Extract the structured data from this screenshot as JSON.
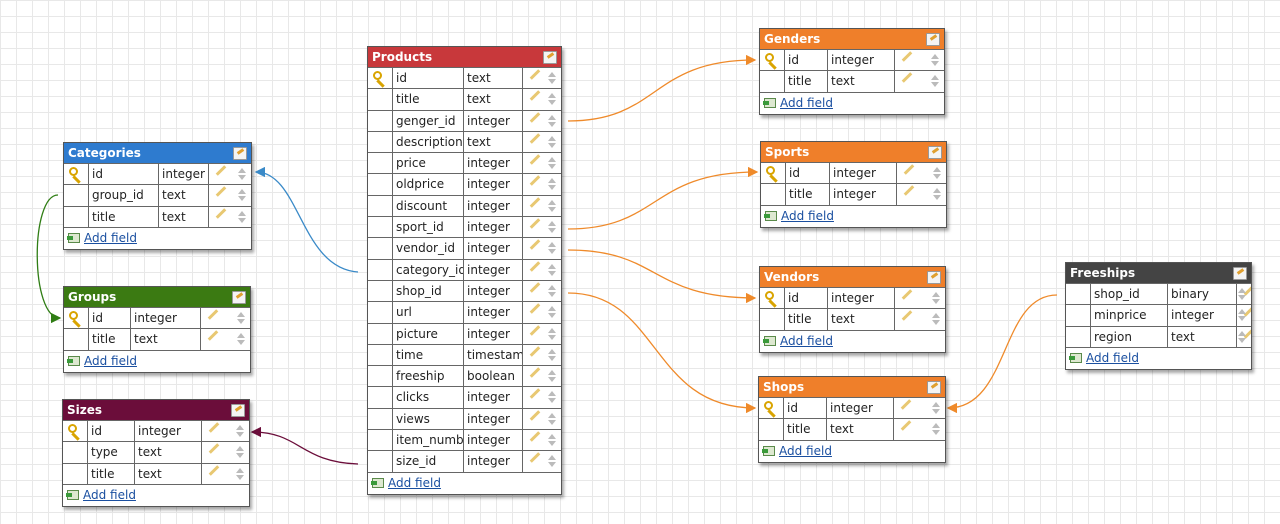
{
  "colors": {
    "blue": "#2e7bcf",
    "green": "#3b7a12",
    "maroon": "#6b0d3a",
    "red": "#c8383b",
    "orange": "#ef7f2a",
    "dark": "#444444",
    "link_blue": "#3a8ac8",
    "link_orange": "#ef8a2a",
    "link_green": "#2f7d14",
    "link_maroon": "#6b0d3a"
  },
  "add_field_label": "Add field",
  "tables": {
    "categories": {
      "title": "Categories",
      "fields": [
        {
          "name": "id",
          "type": "integer",
          "pk": true
        },
        {
          "name": "group_id",
          "type": "text",
          "pk": false
        },
        {
          "name": "title",
          "type": "text",
          "pk": false
        }
      ]
    },
    "groups": {
      "title": "Groups",
      "fields": [
        {
          "name": "id",
          "type": "integer",
          "pk": true
        },
        {
          "name": "title",
          "type": "text",
          "pk": false
        }
      ]
    },
    "sizes": {
      "title": "Sizes",
      "fields": [
        {
          "name": "id",
          "type": "integer",
          "pk": true
        },
        {
          "name": "type",
          "type": "text",
          "pk": false
        },
        {
          "name": "title",
          "type": "text",
          "pk": false
        }
      ]
    },
    "products": {
      "title": "Products",
      "fields": [
        {
          "name": "id",
          "type": "text",
          "pk": true
        },
        {
          "name": "title",
          "type": "text",
          "pk": false
        },
        {
          "name": "genger_id",
          "type": "integer",
          "pk": false
        },
        {
          "name": "description",
          "type": "text",
          "pk": false
        },
        {
          "name": "price",
          "type": "integer",
          "pk": false
        },
        {
          "name": "oldprice",
          "type": "integer",
          "pk": false
        },
        {
          "name": "discount",
          "type": "integer",
          "pk": false
        },
        {
          "name": "sport_id",
          "type": "integer",
          "pk": false
        },
        {
          "name": "vendor_id",
          "type": "integer",
          "pk": false
        },
        {
          "name": "category_id",
          "type": "integer",
          "pk": false
        },
        {
          "name": "shop_id",
          "type": "integer",
          "pk": false
        },
        {
          "name": "url",
          "type": "integer",
          "pk": false
        },
        {
          "name": "picture",
          "type": "integer",
          "pk": false
        },
        {
          "name": "time",
          "type": "timestamp",
          "pk": false
        },
        {
          "name": "freeship",
          "type": "boolean",
          "pk": false
        },
        {
          "name": "clicks",
          "type": "integer",
          "pk": false
        },
        {
          "name": "views",
          "type": "integer",
          "pk": false
        },
        {
          "name": "item_number",
          "type": "integer",
          "pk": false
        },
        {
          "name": "size_id",
          "type": "integer",
          "pk": false
        }
      ]
    },
    "genders": {
      "title": "Genders",
      "fields": [
        {
          "name": "id",
          "type": "integer",
          "pk": true
        },
        {
          "name": "title",
          "type": "text",
          "pk": false
        }
      ]
    },
    "sports": {
      "title": "Sports",
      "fields": [
        {
          "name": "id",
          "type": "integer",
          "pk": true
        },
        {
          "name": "title",
          "type": "integer",
          "pk": false
        }
      ]
    },
    "vendors": {
      "title": "Vendors",
      "fields": [
        {
          "name": "id",
          "type": "integer",
          "pk": true
        },
        {
          "name": "title",
          "type": "text",
          "pk": false
        }
      ]
    },
    "shops": {
      "title": "Shops",
      "fields": [
        {
          "name": "id",
          "type": "integer",
          "pk": true
        },
        {
          "name": "title",
          "type": "text",
          "pk": false
        }
      ]
    },
    "freeships": {
      "title": "Freeships",
      "fields": [
        {
          "name": "shop_id",
          "type": "binary",
          "pk": false
        },
        {
          "name": "minprice",
          "type": "integer",
          "pk": false
        },
        {
          "name": "region",
          "type": "text",
          "pk": false
        }
      ]
    }
  }
}
